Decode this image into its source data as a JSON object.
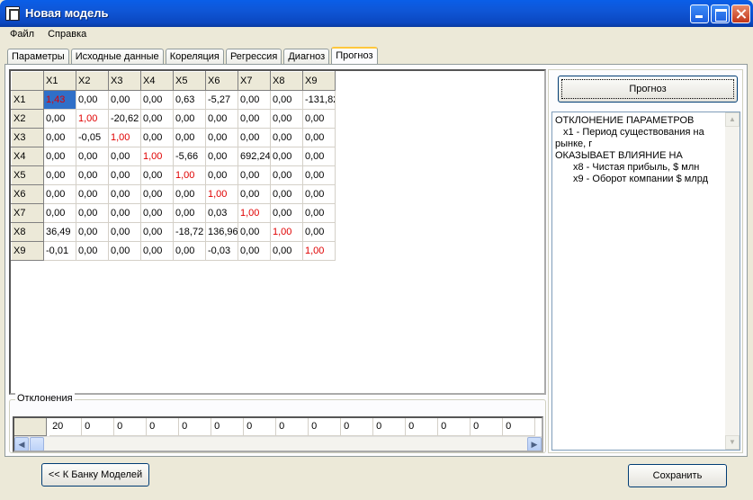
{
  "window": {
    "title": "Новая модель"
  },
  "menu": [
    "Файл",
    "Справка"
  ],
  "tabs": [
    "Параметры",
    "Исходные данные",
    "Кореляция",
    "Регрессия",
    "Диагноз",
    "Прогноз"
  ],
  "active_tab": "Прогноз",
  "grid": {
    "col_headers": [
      "X1",
      "X2",
      "X3",
      "X4",
      "X5",
      "X6",
      "X7",
      "X8",
      "X9"
    ],
    "rows": [
      {
        "header": "X1",
        "cells": [
          "1,43",
          "0,00",
          "0,00",
          "0,00",
          "0,63",
          "-5,27",
          "0,00",
          "0,00",
          "-131,82"
        ]
      },
      {
        "header": "X2",
        "cells": [
          "0,00",
          "1,00",
          "-20,62",
          "0,00",
          "0,00",
          "0,00",
          "0,00",
          "0,00",
          "0,00"
        ]
      },
      {
        "header": "X3",
        "cells": [
          "0,00",
          "-0,05",
          "1,00",
          "0,00",
          "0,00",
          "0,00",
          "0,00",
          "0,00",
          "0,00"
        ]
      },
      {
        "header": "X4",
        "cells": [
          "0,00",
          "0,00",
          "0,00",
          "1,00",
          "-5,66",
          "0,00",
          "692,24",
          "0,00",
          "0,00"
        ]
      },
      {
        "header": "X5",
        "cells": [
          "0,00",
          "0,00",
          "0,00",
          "0,00",
          "1,00",
          "0,00",
          "0,00",
          "0,00",
          "0,00"
        ]
      },
      {
        "header": "X6",
        "cells": [
          "0,00",
          "0,00",
          "0,00",
          "0,00",
          "0,00",
          "1,00",
          "0,00",
          "0,00",
          "0,00"
        ]
      },
      {
        "header": "X7",
        "cells": [
          "0,00",
          "0,00",
          "0,00",
          "0,00",
          "0,00",
          "0,03",
          "1,00",
          "0,00",
          "0,00"
        ]
      },
      {
        "header": "X8",
        "cells": [
          "36,49",
          "0,00",
          "0,00",
          "0,00",
          "-18,72",
          "136,96",
          "0,00",
          "1,00",
          "0,00"
        ]
      },
      {
        "header": "X9",
        "cells": [
          "-0,01",
          "0,00",
          "0,00",
          "0,00",
          "0,00",
          "-0,03",
          "0,00",
          "0,00",
          "1,00"
        ]
      }
    ]
  },
  "deviations": {
    "label": "Отклонения",
    "values": [
      "20",
      "0",
      "0",
      "0",
      "0",
      "0",
      "0",
      "0",
      "0",
      "0",
      "0",
      "0",
      "0",
      "0",
      "0"
    ]
  },
  "forecast_button": "Прогноз",
  "output": {
    "lines": [
      {
        "text": "ОТКЛОНЕНИЕ ПАРАМЕТРОВ",
        "indent": 0
      },
      {
        "text": "x1 - Период существования на",
        "indent": 1
      },
      {
        "text": "рынке, г",
        "indent": 0
      },
      {
        "text": "ОКАЗЫВАЕТ ВЛИЯНИЕ НА",
        "indent": 0
      },
      {
        "text": "x8  -  Чистая прибыль, $ млн",
        "indent": 2
      },
      {
        "text": "x9  -  Оборот компании $ млрд",
        "indent": 2
      }
    ]
  },
  "bottom": {
    "back_button": "<< К Банку Моделей",
    "save_button": "Сохранить"
  },
  "colors": {
    "titlebar": "#0b4fd0",
    "diagonal_text": "#e00000",
    "selection": "#2f6fc8"
  }
}
